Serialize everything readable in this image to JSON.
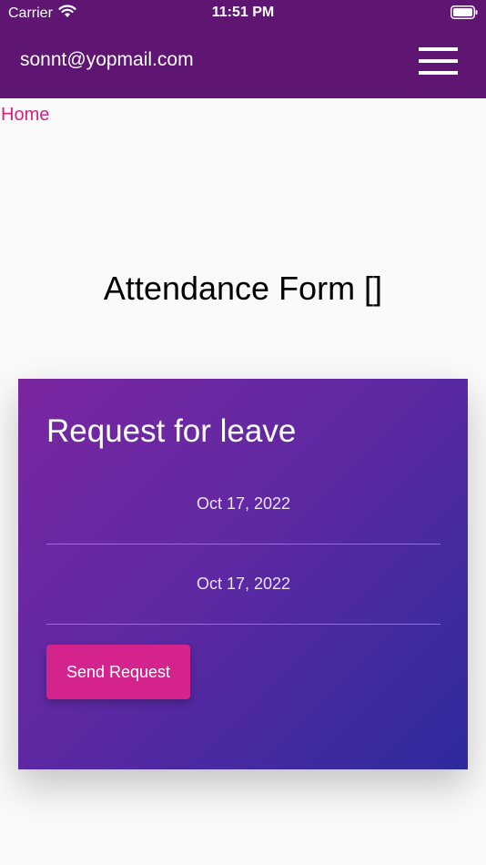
{
  "status_bar": {
    "carrier": "Carrier",
    "time": "11:51 PM"
  },
  "nav": {
    "email": "sonnt@yopmail.com",
    "menu_icon": "hamburger-menu-icon"
  },
  "breadcrumb": {
    "home_label": "Home"
  },
  "page": {
    "title": "Attendance Form []"
  },
  "leave_card": {
    "title": "Request for leave",
    "start_date": "Oct 17, 2022",
    "end_date": "Oct 17, 2022",
    "send_label": "Send Request"
  },
  "colors": {
    "header_bg": "#5f1673",
    "accent_pink": "#d4237d",
    "card_gradient_start": "#7a26a0",
    "card_gradient_end": "#2d2a9e"
  }
}
